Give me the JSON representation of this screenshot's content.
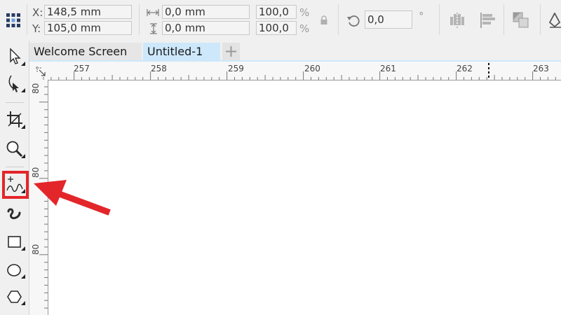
{
  "property_bar": {
    "x_label": "X:",
    "x_value": "148,5 mm",
    "y_label": "Y:",
    "y_value": "105,0 mm",
    "width_value": "0,0 mm",
    "height_value": "0,0 mm",
    "scale_x": "100,0",
    "scale_y": "100,0",
    "percent": "%",
    "rotation_value": "0,0",
    "degree": "°"
  },
  "tabs": [
    {
      "label": "Welcome Screen",
      "active": false
    },
    {
      "label": "Untitled-1",
      "active": true
    }
  ],
  "ruler": {
    "horizontal": [
      "257",
      "258",
      "259",
      "260",
      "261",
      "262",
      "263"
    ],
    "vertical": [
      "80",
      "80",
      "80"
    ]
  },
  "toolbox": {
    "tools": [
      "pick-tool",
      "shape-tool",
      "crop-tool",
      "zoom-tool",
      "freehand-tool",
      "artistic-media-tool",
      "rectangle-tool",
      "ellipse-tool",
      "polygon-tool"
    ],
    "highlighted_tool": "freehand-tool"
  },
  "colors": {
    "active_tab": "#cde8fb",
    "highlight": "#e3262a",
    "canvas": "#ffffff"
  }
}
